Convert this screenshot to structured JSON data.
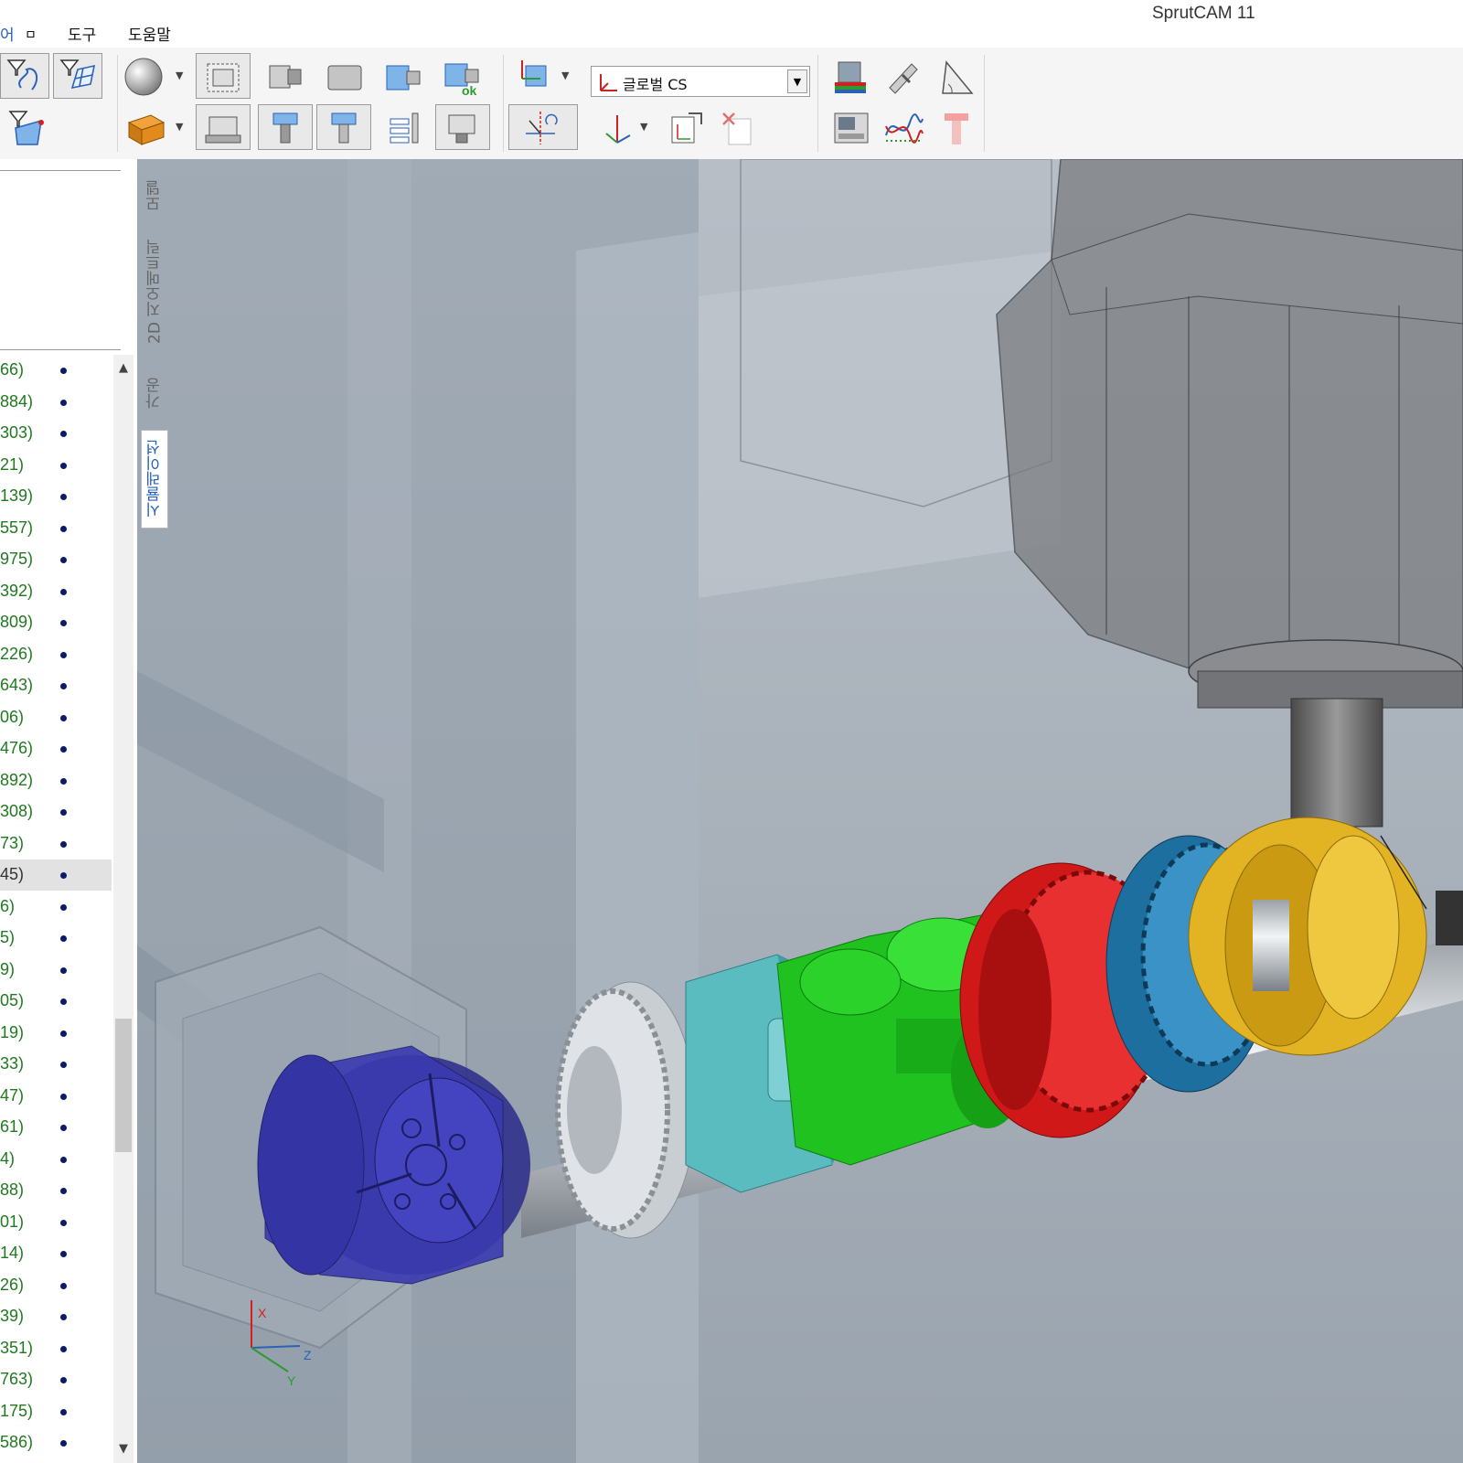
{
  "app": {
    "title": "SprutCAM 11"
  },
  "menu": {
    "items": [
      {
        "label": "어"
      },
      {
        "label": "ㅁ"
      },
      {
        "label": "도구"
      },
      {
        "label": "도움말"
      }
    ]
  },
  "toolbar": {
    "coordinate_system": {
      "selected": "글로벌 CS"
    },
    "buttons": [
      "filter-curve-icon",
      "filter-surface-icon",
      "filter-face-icon",
      "sphere-icon",
      "workpiece-icon",
      "part-icon",
      "fixture-icon",
      "tool-icon",
      "tool-ok-icon",
      "machine-view-icon",
      "cs-icon",
      "section-view-icon",
      "axis-icon",
      "export-icon",
      "delete-cs-icon",
      "color-scale-icon",
      "caliper-icon",
      "angle-measure-icon",
      "machine-panel-icon",
      "graph-icon",
      "tool-shape-icon"
    ]
  },
  "tabs": {
    "vertical": [
      {
        "label": "모델"
      },
      {
        "label": "2D 지오메트릭"
      },
      {
        "label": "가공"
      },
      {
        "label": "시뮬레이션",
        "active": true
      }
    ]
  },
  "operations": {
    "items": [
      {
        "label": "66)"
      },
      {
        "label": "884)"
      },
      {
        "label": "303)"
      },
      {
        "label": "21)"
      },
      {
        "label": "139)"
      },
      {
        "label": "557)"
      },
      {
        "label": "975)"
      },
      {
        "label": "392)"
      },
      {
        "label": "809)"
      },
      {
        "label": "226)"
      },
      {
        "label": "643)"
      },
      {
        "label": "06)"
      },
      {
        "label": "476)"
      },
      {
        "label": "892)"
      },
      {
        "label": "308)"
      },
      {
        "label": "73)"
      },
      {
        "label": "45)",
        "selected": true
      },
      {
        "label": "6)"
      },
      {
        "label": "5)"
      },
      {
        "label": "9)"
      },
      {
        "label": "05)"
      },
      {
        "label": "19)"
      },
      {
        "label": "33)"
      },
      {
        "label": "47)"
      },
      {
        "label": "61)"
      },
      {
        "label": "4)"
      },
      {
        "label": "88)"
      },
      {
        "label": "01)"
      },
      {
        "label": "14)"
      },
      {
        "label": "26)"
      },
      {
        "label": "39)"
      },
      {
        "label": "351)"
      },
      {
        "label": "763)"
      },
      {
        "label": "175)"
      },
      {
        "label": "586)"
      }
    ]
  },
  "viewport": {
    "axes": {
      "x": "X",
      "y": "Y",
      "z": "Z"
    },
    "colors": {
      "background_top": "#b8bec6",
      "background_bottom": "#9aa4ae",
      "chuck": "#3a3ab0",
      "gear_silver": "#d0d4d8",
      "cube_teal": "#5bbcc0",
      "part_green": "#1fc21f",
      "gear_red": "#d01818",
      "gear_blue": "#1d6fa0",
      "part_gold": "#e2b322",
      "spindle": "#6a6a6a"
    }
  },
  "scrollbar": {
    "up": "▲",
    "down": "▼"
  }
}
